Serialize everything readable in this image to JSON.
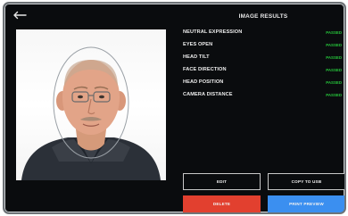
{
  "header": {
    "title": "IMAGE RESULTS"
  },
  "icons": {
    "back": "back-arrow-icon"
  },
  "photo": {
    "description_hidden": ""
  },
  "results": [
    {
      "label": "NEUTRAL EXPRESSION",
      "status": "PASSED"
    },
    {
      "label": "EYES OPEN",
      "status": "PASSED"
    },
    {
      "label": "HEAD TILT",
      "status": "PASSED"
    },
    {
      "label": "FACE DIRECTION",
      "status": "PASSED"
    },
    {
      "label": "HEAD POSITION",
      "status": "PASSED"
    },
    {
      "label": "CAMERA DISTANCE",
      "status": "PASSED"
    }
  ],
  "actions": {
    "edit": "EDIT",
    "copy_to_usb": "COPY TO USB",
    "delete": "DELETE",
    "print_preview": "PRINT PREVIEW"
  },
  "colors": {
    "background": "#0a0c0e",
    "pass": "#25c23a",
    "delete": "#e2402f",
    "print": "#3b8ff0"
  }
}
